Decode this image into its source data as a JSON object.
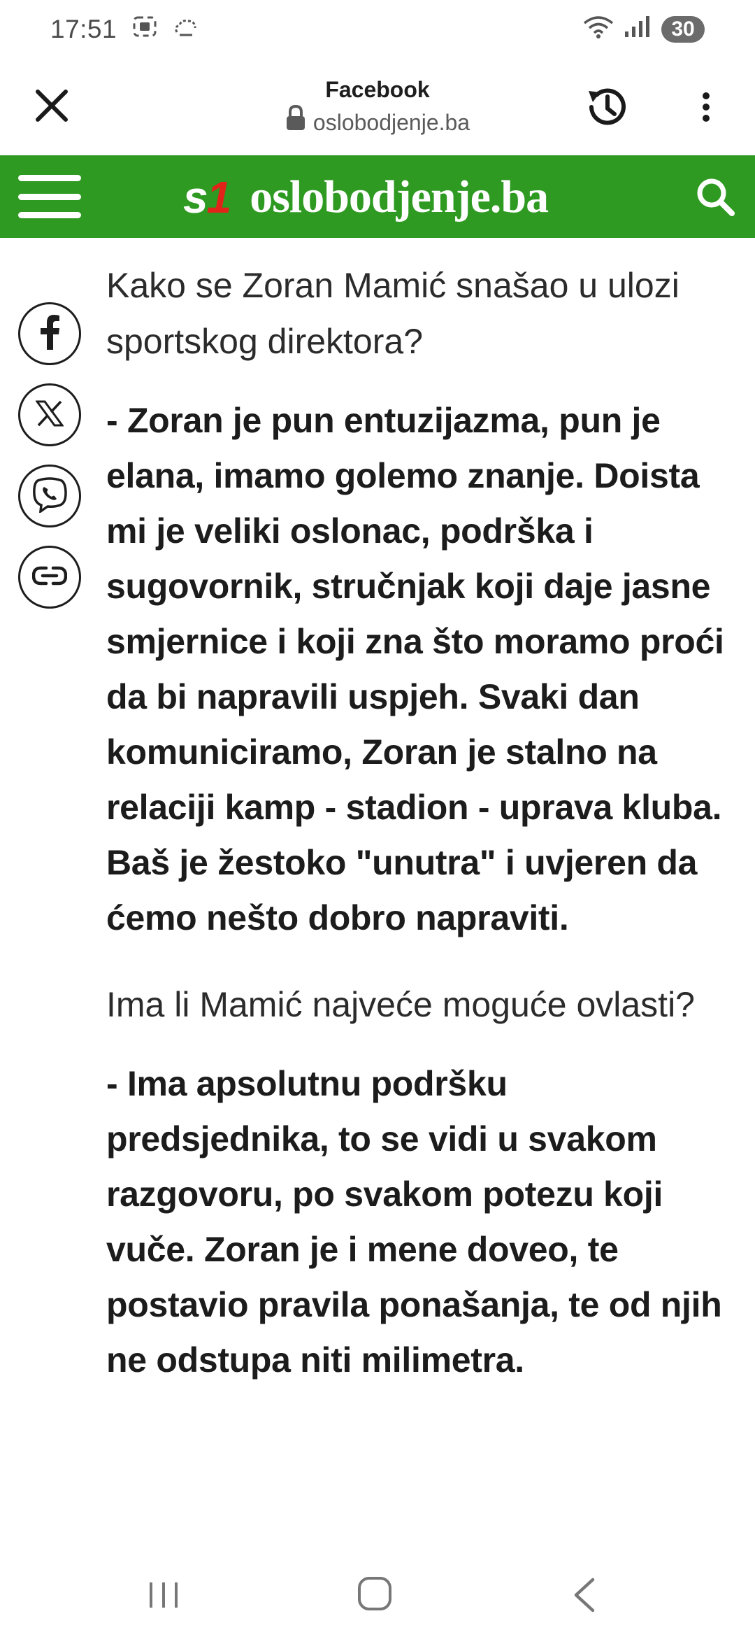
{
  "status_bar": {
    "time": "17:51",
    "battery": "30",
    "icons": [
      "screenshot-icon",
      "weather-icon",
      "wifi-icon",
      "signal-icon"
    ]
  },
  "browser": {
    "source_title": "Facebook",
    "url": "oslobodjenje.ba",
    "icons": [
      "close-icon",
      "lock-icon",
      "history-icon",
      "more-vert-icon"
    ]
  },
  "site_header": {
    "brand_mark_s": "s",
    "brand_mark_one": "1",
    "brand_name": "oslobodjenje.ba",
    "header_color": "#2e9a22",
    "icons": [
      "hamburger-menu-icon",
      "search-icon"
    ]
  },
  "share_bar": {
    "items": [
      "facebook-icon",
      "x-icon",
      "viber-icon",
      "link-icon"
    ]
  },
  "article": {
    "blocks": [
      {
        "type": "question",
        "text": "Kako se Zoran Mamić snašao u ulozi sportskog direktora?"
      },
      {
        "type": "answer",
        "text": "- Zoran je pun entuzijazma, pun je elana, imamo golemo znanje. Doista mi je veliki oslonac, podrška i sugovornik, stručnjak koji daje jasne smjernice i koji zna što moramo proći da bi napravili uspjeh. Svaki dan komuniciramo, Zoran je stalno na relaciji kamp - stadion - uprava kluba. Baš je žestoko \"unutra\" i uvjeren da ćemo nešto dobro napraviti."
      },
      {
        "type": "question",
        "text": "Ima li Mamić najveće moguće ovlasti?"
      },
      {
        "type": "answer",
        "text": "- Ima apsolutnu podršku predsjednika, to se vidi u svakom razgovoru, po svakom potezu koji vuče. Zoran je i mene doveo, te postavio pravila ponašanja, te od njih ne odstupa niti milimetra."
      }
    ]
  },
  "nav_bar": {
    "icons": [
      "recent-apps-icon",
      "home-icon",
      "back-icon"
    ]
  }
}
